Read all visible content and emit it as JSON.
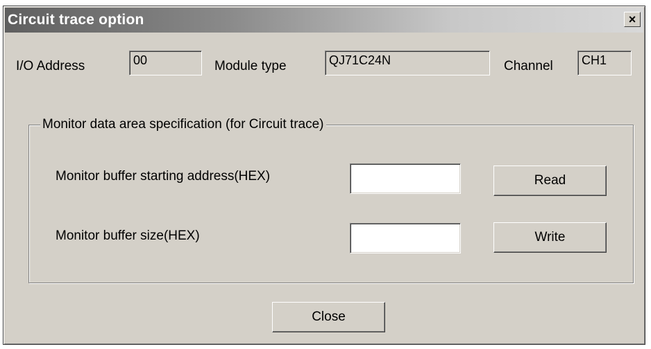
{
  "window": {
    "title": "Circuit trace option",
    "close_glyph": "×"
  },
  "info_row": {
    "io_address_label": "I/O Address",
    "io_address_value": "00",
    "module_type_label": "Module type",
    "module_type_value": "QJ71C24N",
    "channel_label": "Channel",
    "channel_value": "CH1"
  },
  "monitor_group": {
    "legend": "Monitor data area specification (for Circuit trace)",
    "start_address_label": "Monitor buffer starting address(HEX)",
    "start_address_value": "",
    "size_label": "Monitor buffer size(HEX)",
    "size_value": "",
    "read_label": "Read",
    "write_label": "Write"
  },
  "footer": {
    "close_label": "Close"
  },
  "colors": {
    "dialog_face": "#d4d0c8",
    "titlebar_start": "#5f5f5f",
    "titlebar_end": "#d8d8d8",
    "title_text": "#ffffff"
  },
  "icons": {
    "close": "close-icon"
  }
}
